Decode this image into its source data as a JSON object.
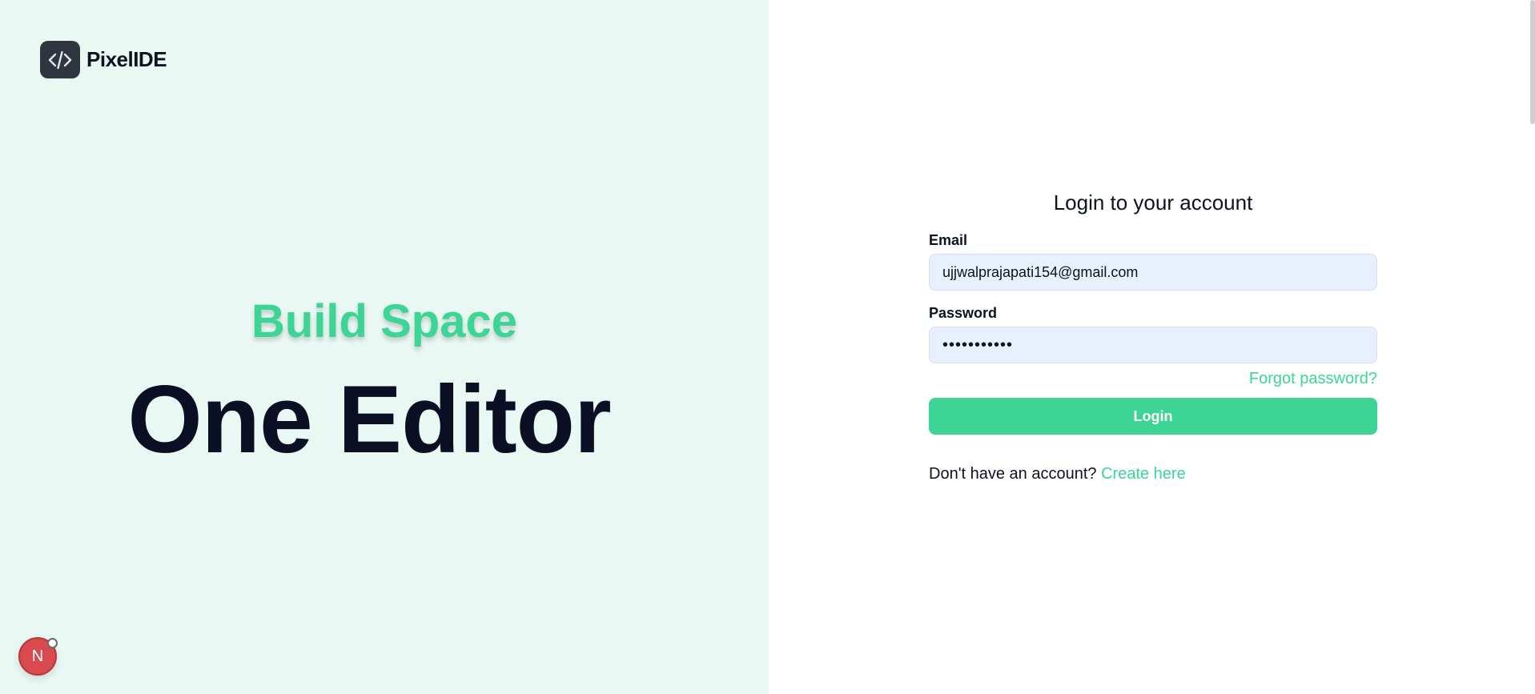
{
  "brand": {
    "name": "PixelIDE",
    "logo_icon": "code-brackets-icon"
  },
  "hero": {
    "subtitle": "Build Space",
    "title": "One Editor"
  },
  "badge": {
    "letter": "N"
  },
  "login": {
    "title": "Login to your account",
    "email_label": "Email",
    "email_value": "ujjwalprajapati154@gmail.com",
    "password_label": "Password",
    "password_value": "•••••••••••",
    "forgot_link": "Forgot password?",
    "submit_label": "Login",
    "signup_prompt": "Don't have an account?",
    "signup_link": "Create here"
  },
  "colors": {
    "accent": "#3cd596",
    "left_background": "#e9f8f3",
    "input_background": "#e8f0fe",
    "title_dark": "#0a0f23"
  }
}
